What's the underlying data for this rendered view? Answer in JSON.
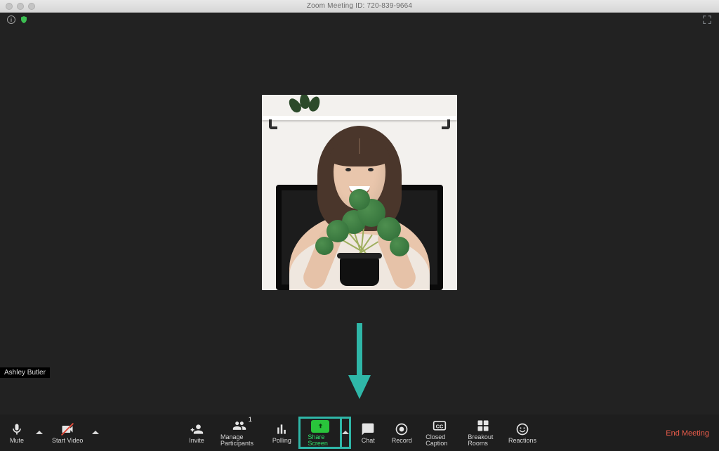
{
  "titlebar": {
    "title": "Zoom Meeting ID: 720-839-9664"
  },
  "topbar": {
    "info": "i"
  },
  "participant": {
    "name": "Ashley Butler"
  },
  "toolbar": {
    "mute": "Mute",
    "start_video": "Start Video",
    "invite": "Invite",
    "manage_participants": "Manage Participants",
    "participants_count": "1",
    "polling": "Polling",
    "share_screen": "Share Screen",
    "chat": "Chat",
    "record": "Record",
    "closed_caption": "Closed Caption",
    "breakout_rooms": "Breakout Rooms",
    "reactions": "Reactions",
    "end_meeting": "End Meeting"
  },
  "colors": {
    "accent_teal": "#2fb7a8",
    "share_green": "#29c43b",
    "end_red": "#e95c4a"
  }
}
